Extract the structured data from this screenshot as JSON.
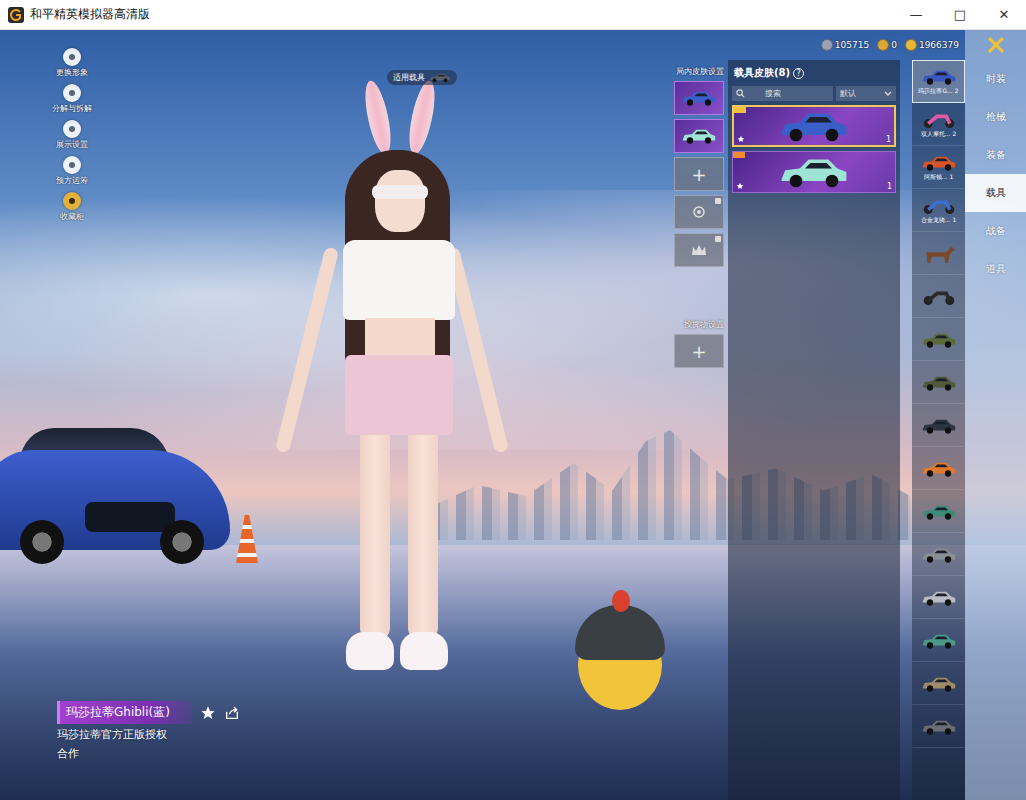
{
  "window": {
    "title": "和平精英模拟器高清版",
    "controls": [
      "—",
      "□",
      "✕"
    ]
  },
  "currencies": [
    {
      "amount": "105715",
      "color": "#9aa3b5"
    },
    {
      "amount": "0",
      "color": "#d9a93a"
    },
    {
      "amount": "1966379",
      "color": "#e6b93c"
    }
  ],
  "side_menu": [
    {
      "label": "更换形象",
      "color": "#ffffff"
    },
    {
      "label": "分解与拆解",
      "color": "#ffffff"
    },
    {
      "label": "展示设置",
      "color": "#ffffff"
    },
    {
      "label": "预方运筹",
      "color": "#ffffff"
    },
    {
      "label": "收藏柜",
      "color": "#e3b23c"
    }
  ],
  "applicable_vehicle": {
    "label": "适用载具"
  },
  "in_match_skins": {
    "title": "局内皮肤设置",
    "slots": [
      {
        "kind": "skin",
        "color": "#3a5fc8"
      },
      {
        "kind": "skin",
        "color": "#9fe3d6"
      },
      {
        "kind": "add",
        "icon": "+"
      },
      {
        "kind": "emblem"
      },
      {
        "kind": "crown"
      }
    ]
  },
  "throwable": {
    "title": "投掷物设置",
    "icon": "+"
  },
  "skin_panel": {
    "title": "载具皮肤(8)",
    "help": "?",
    "search": "搜索",
    "sort": "默认",
    "cards": [
      {
        "selected": true,
        "count": "1",
        "color": "#3a5fc8"
      },
      {
        "selected": false,
        "count": "1",
        "color": "#9fe3d6"
      }
    ]
  },
  "vehicles": [
    {
      "name": "玛莎拉蒂G...",
      "count": "2",
      "selected": true,
      "kind": "car",
      "color": "#3b57c0"
    },
    {
      "name": "双人摩托...",
      "count": "2",
      "selected": false,
      "kind": "moto",
      "color": "#e05aa8"
    },
    {
      "name": "阿斯顿...",
      "count": "1",
      "selected": false,
      "kind": "car",
      "color": "#d8552a"
    },
    {
      "name": "合金龙骑...",
      "count": "1",
      "selected": false,
      "kind": "moto",
      "color": "#3d6fd0"
    },
    {
      "selected": false,
      "kind": "horse",
      "color": "#7a4a2a"
    },
    {
      "selected": false,
      "kind": "moto",
      "color": "#2b2b2b"
    },
    {
      "selected": false,
      "kind": "car",
      "color": "#5a6a3a"
    },
    {
      "selected": false,
      "kind": "car",
      "color": "#4e5a38"
    },
    {
      "selected": false,
      "kind": "car",
      "color": "#2e3440"
    },
    {
      "selected": false,
      "kind": "car",
      "color": "#e07a2a"
    },
    {
      "selected": false,
      "kind": "car",
      "color": "#3f8a78"
    },
    {
      "selected": false,
      "kind": "car",
      "color": "#8a8f96"
    },
    {
      "selected": false,
      "kind": "car",
      "color": "#b8bcc4"
    },
    {
      "selected": false,
      "kind": "car",
      "color": "#4a9a8a"
    },
    {
      "selected": false,
      "kind": "car",
      "color": "#a08a68"
    },
    {
      "selected": false,
      "kind": "car",
      "color": "#6a6e74"
    }
  ],
  "tabs": [
    {
      "label": "时装",
      "selected": false
    },
    {
      "label": "枪械",
      "selected": false
    },
    {
      "label": "装备",
      "selected": false
    },
    {
      "label": "载具",
      "selected": true
    },
    {
      "label": "战备",
      "selected": false
    },
    {
      "label": "道具",
      "selected": false
    }
  ],
  "item_info": {
    "name": "玛莎拉蒂Ghibli(蓝)",
    "description": [
      "玛莎拉蒂官方正版授权",
      "合作"
    ]
  }
}
